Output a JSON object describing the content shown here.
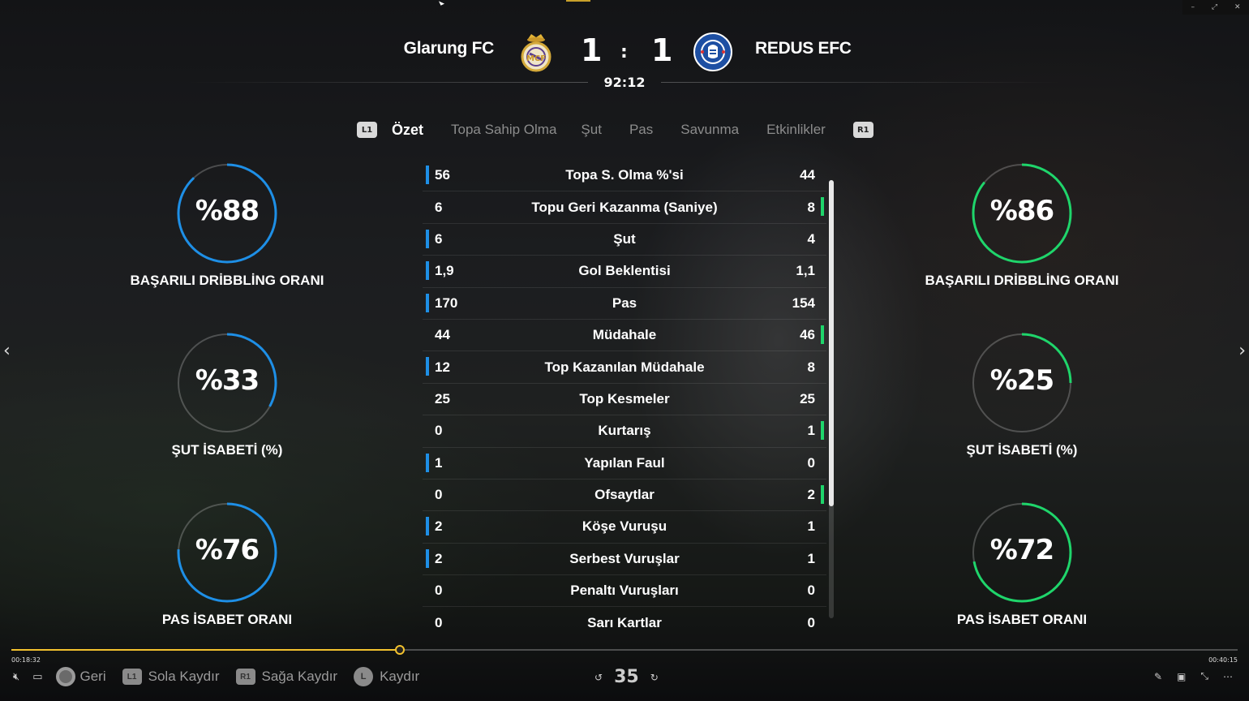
{
  "match": {
    "home_team": "Glarung FC",
    "away_team": "REDUS EFC",
    "home_score": "1",
    "away_score": "1",
    "separator": ":",
    "time": "92:12"
  },
  "tabs": {
    "left_button": "L1",
    "right_button": "R1",
    "items": [
      "Özet",
      "Topa Sahip Olma",
      "Şut",
      "Pas",
      "Savunma",
      "Etkinlikler"
    ],
    "active": "Özet"
  },
  "gauges": {
    "home": [
      {
        "value_text": "%88",
        "value": 88,
        "label": "BAŞARILI DRİBBLİNG ORANI"
      },
      {
        "value_text": "%33",
        "value": 33,
        "label": "ŞUT İSABETİ (%)"
      },
      {
        "value_text": "%76",
        "value": 76,
        "label": "PAS İSABET ORANI"
      }
    ],
    "away": [
      {
        "value_text": "%86",
        "value": 86,
        "label": "BAŞARILI DRİBBLİNG ORANI"
      },
      {
        "value_text": "%25",
        "value": 25,
        "label": "ŞUT İSABETİ (%)"
      },
      {
        "value_text": "%72",
        "value": 72,
        "label": "PAS İSABET ORANI"
      }
    ],
    "home_color": "#1e8fe6",
    "away_color": "#1fd56b"
  },
  "stats": [
    {
      "label": "Topa S. Olma %'si",
      "home": "56",
      "away": "44",
      "lead": "home"
    },
    {
      "label": "Topu Geri Kazanma (Saniye)",
      "home": "6",
      "away": "8",
      "lead": "away"
    },
    {
      "label": "Şut",
      "home": "6",
      "away": "4",
      "lead": "home"
    },
    {
      "label": "Gol Beklentisi",
      "home": "1,9",
      "away": "1,1",
      "lead": "home"
    },
    {
      "label": "Pas",
      "home": "170",
      "away": "154",
      "lead": "home"
    },
    {
      "label": "Müdahale",
      "home": "44",
      "away": "46",
      "lead": "away"
    },
    {
      "label": "Top Kazanılan Müdahale",
      "home": "12",
      "away": "8",
      "lead": "home"
    },
    {
      "label": "Top Kesmeler",
      "home": "25",
      "away": "25",
      "lead": "none"
    },
    {
      "label": "Kurtarış",
      "home": "0",
      "away": "1",
      "lead": "away"
    },
    {
      "label": "Yapılan Faul",
      "home": "1",
      "away": "0",
      "lead": "home"
    },
    {
      "label": "Ofsaytlar",
      "home": "0",
      "away": "2",
      "lead": "away"
    },
    {
      "label": "Köşe Vuruşu",
      "home": "2",
      "away": "1",
      "lead": "home"
    },
    {
      "label": "Serbest Vuruşlar",
      "home": "2",
      "away": "1",
      "lead": "home"
    },
    {
      "label": "Penaltı Vuruşları",
      "home": "0",
      "away": "0",
      "lead": "none"
    },
    {
      "label": "Sarı Kartlar",
      "home": "0",
      "away": "0",
      "lead": "none"
    }
  ],
  "player": {
    "elapsed": "00:18:32",
    "total": "00:40:15",
    "progress": 0.317,
    "accent": "#f2c12e",
    "hints": {
      "back": "Geri",
      "scroll_left_button": "L1",
      "scroll_left": "Sola Kaydır",
      "scroll_right_button": "R1",
      "scroll_right": "Sağa Kaydır",
      "stick_button": "L",
      "scroll": "Kaydır"
    },
    "skip_seconds": "35"
  }
}
